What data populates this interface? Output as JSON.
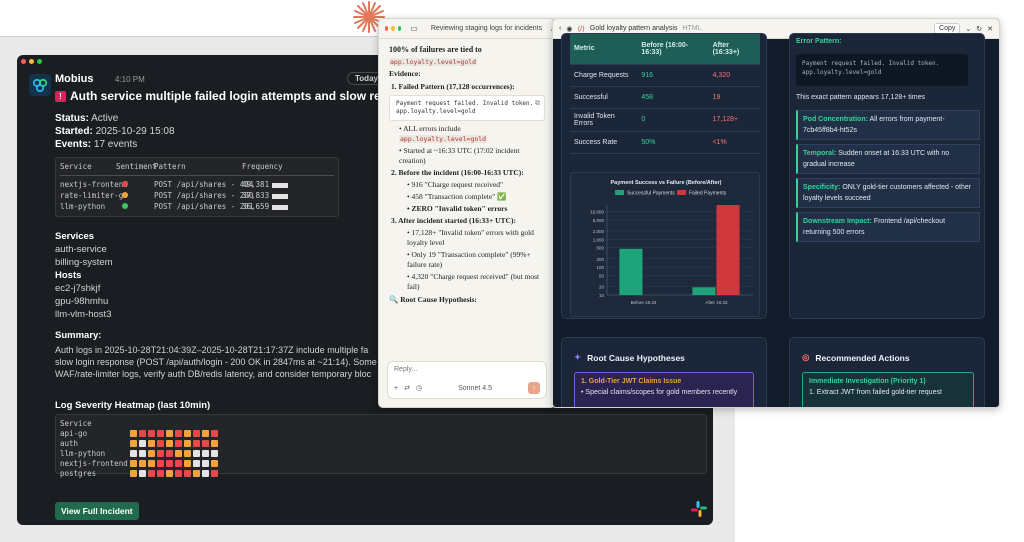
{
  "slack": {
    "bot_name": "Mobius",
    "time": "4:10 PM",
    "today": "Today",
    "title": "Auth service multiple failed login attempts and slow responses",
    "status_label": "Status:",
    "status": "Active",
    "started_label": "Started:",
    "started": "2025-10-29 15:08",
    "events_label": "Events:",
    "events": "17 events",
    "table_headers": [
      "Service",
      "Sentiment",
      "Pattern",
      "Frequency"
    ],
    "table_rows": [
      {
        "service": "nextjs-frontend",
        "sentiment_color": "#e8484a",
        "pattern": "POST /api/shares - 404",
        "frequency": "49,381"
      },
      {
        "service": "rate-limiter-go",
        "sentiment_color": "#f2a33a",
        "pattern": "POST /api/shares - 200",
        "frequency": "37,833"
      },
      {
        "service": "llm-python",
        "sentiment_color": "#3cc468",
        "pattern": "POST /api/shares - 201",
        "frequency": "36,659"
      }
    ],
    "services_heading": "Services",
    "services": [
      "auth-service",
      "billing-system"
    ],
    "hosts_heading": "Hosts",
    "hosts": [
      "ec2-j7shkjf",
      "gpu-98hmhu",
      "llm-vlm-host3"
    ],
    "summary_heading": "Summary:",
    "summary_lines": [
      "Auth logs in 2025-10-28T21:04:39Z–2025-10-28T21:17:37Z include multiple fa",
      "slow login response (POST /api/auth/login - 200 OK in 2847ms at ~21:14). Some",
      "WAF/rate-limiter logs, verify auth DB/redis latency, and consider temporary bloc"
    ],
    "heatmap_heading": "Log Severity Heatmap (last 10min)",
    "heatmap_label": "Service",
    "heatmap_rows": [
      {
        "name": "api-go",
        "cells": [
          "#f2a33a",
          "#e8484a",
          "#e8484a",
          "#e8484a",
          "#f2a33a",
          "#e8484a",
          "#f2a33a",
          "#e8484a",
          "#f2a33a",
          "#e8484a"
        ]
      },
      {
        "name": "auth",
        "cells": [
          "#f2a33a",
          "#e3e3e3",
          "#f2a33a",
          "#e8484a",
          "#f2a33a",
          "#e8484a",
          "#f2a33a",
          "#e8484a",
          "#e8484a",
          "#f2a33a"
        ]
      },
      {
        "name": "llm-python",
        "cells": [
          "#e3e3e3",
          "#e3e3e3",
          "#f2a33a",
          "#e8484a",
          "#e8484a",
          "#f2a33a",
          "#f2a33a",
          "#e3e3e3",
          "#e3e3e3",
          "#e3e3e3"
        ]
      },
      {
        "name": "nextjs-frontend",
        "cells": [
          "#f2a33a",
          "#f2a33a",
          "#f2a33a",
          "#e8484a",
          "#e8484a",
          "#e8484a",
          "#f2a33a",
          "#e3e3e3",
          "#e3e3e3",
          "#f2a33a"
        ]
      },
      {
        "name": "postgres",
        "cells": [
          "#f2a33a",
          "#e3e3e3",
          "#e8484a",
          "#e8484a",
          "#f2a33a",
          "#e8484a",
          "#e8484a",
          "#f2a33a",
          "#e3e3e3",
          "#e8484a"
        ]
      }
    ],
    "view_button": "View Full Incident"
  },
  "chat": {
    "title": "Reviewing staging logs for incidents",
    "lead_1": "100% of failures are tied to",
    "lead_code": "app.loyalty.level=gold",
    "evidence": "Evidence:",
    "item1": "1. Failed Pattern (17,128 occurrences):",
    "code_block": "Payment request failed. Invalid token. app.loyalty.level=gold",
    "b1_pre": "ALL errors include",
    "b1_code": "app.loyalty.level=gold",
    "b2": "Started at ~16:33 UTC (17:02 incident creation)",
    "item2": "2. Before the incident (16:00-16:33 UTC):",
    "b3": "916 \"Charge request received\"",
    "b4": "458 \"Transaction complete\" ✅",
    "b5": "ZERO \"Invalid token\" errors",
    "item3": "3. After incident started (16:33+ UTC):",
    "b6": "17,128+ \"Invalid token\" errors with gold loyalty level",
    "b7": "Only 19 \"Transaction complete\" (99%+ failure rate)",
    "b8": "4,320 \"Charge request received\" (but most fail)",
    "item4": "🔍 Root Cause Hypothesis:",
    "reply_placeholder": "Reply...",
    "model": "Sonnet 4.5"
  },
  "artifact": {
    "title": "Gold loyalty pattern analysis",
    "type": "HTML",
    "copy": "Copy",
    "metric_header": [
      "Metric",
      "Before (16:00-16:33)",
      "After (16:33+)"
    ],
    "metric_rows": [
      {
        "metric": "Charge Requests",
        "before": "916",
        "after": "4,320"
      },
      {
        "metric": "Successful",
        "before": "458",
        "after": "19"
      },
      {
        "metric": "Invalid Token Errors",
        "before": "0",
        "after": "17,128+"
      },
      {
        "metric": "Success Rate",
        "before": "50%",
        "after": "<1%"
      }
    ],
    "error_pattern_label": "Error Pattern:",
    "error_pattern_code": "Payment request failed. Invalid token. app.loyalty.level=gold",
    "pattern_count": "This exact pattern appears 17,128+ times",
    "insights": [
      {
        "label": "Pod Concentration:",
        "text": "All errors from payment-7cb45ff8b4-ht52s"
      },
      {
        "label": "Temporal:",
        "text": "Sudden onset at 16:33 UTC with no gradual increase"
      },
      {
        "label": "Specificity:",
        "text": "ONLY gold-tier customers affected - other loyalty levels succeed"
      },
      {
        "label": "Downstream Impact:",
        "text": "Frontend /api/checkout returning 500 errors"
      }
    ],
    "hyp_heading": "Root Cause Hypotheses",
    "hyp_title": "1. Gold-Tier JWT Claims Issue",
    "hyp_text": "Special claims/scopes for gold members recently",
    "act_heading": "Recommended Actions",
    "act_title": "Immediate Investigation (Priority 1)",
    "act_text": "1. Extract JWT from failed gold-tier request"
  },
  "chart_data": {
    "type": "bar",
    "title": "Payment Success vs Failure (Before/After)",
    "categories": [
      "Before 16:33",
      "After 16:33"
    ],
    "series": [
      {
        "name": "Successful Payments",
        "values": [
          458,
          19
        ],
        "color": "#1fa37a"
      },
      {
        "name": "Failed Payments",
        "values": [
          0,
          17128
        ],
        "color": "#d0383e"
      }
    ],
    "y_scale": "log",
    "y_ticks": [
      "10,000",
      "5,000",
      "2,000",
      "1,000",
      "500",
      "200",
      "100",
      "50",
      "20",
      "10"
    ],
    "ylim": [
      10,
      17128
    ],
    "legend": "top"
  }
}
